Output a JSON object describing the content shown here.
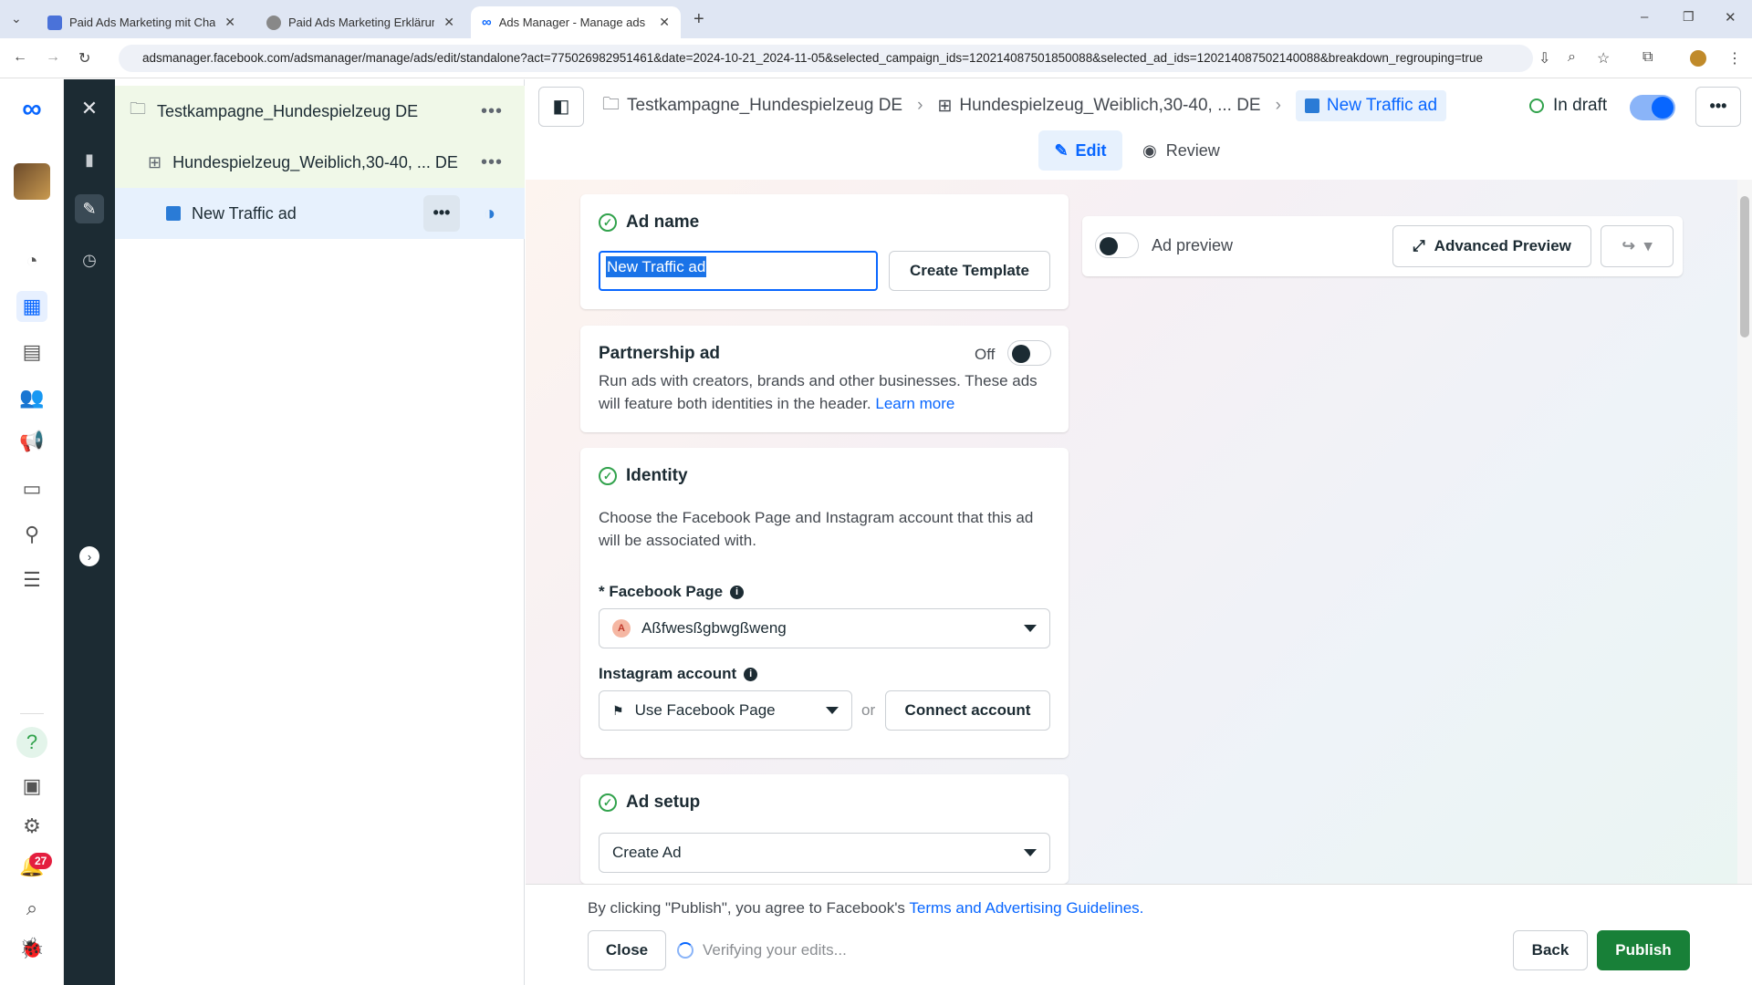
{
  "browser": {
    "tabs": [
      {
        "title": "Paid Ads Marketing mit ChatGPT",
        "fav_color": "#4a72d9"
      },
      {
        "title": "Paid Ads Marketing Erklärung",
        "fav_color": "#666"
      },
      {
        "title": "Ads Manager - Manage ads - A",
        "fav_color": "#0866ff"
      }
    ],
    "new_tab": "+",
    "url": "adsmanager.facebook.com/adsmanager/manage/ads/edit/standalone?act=775026982951461&date=2024-10-21_2024-11-05&selected_campaign_ids=120214087501850088&selected_ad_ids=120214087502140088&breakdown_regrouping=true"
  },
  "tree": {
    "campaign": "Testkampagne_Hundespielzeug DE",
    "adset": "Hundespielzeug_Weiblich,30-40, ... DE",
    "ad": "New Traffic ad",
    "more": "•••"
  },
  "breadcrumb": {
    "campaign": "Testkampagne_Hundespielzeug DE",
    "adset": "Hundespielzeug_Weiblich,30-40, ... DE",
    "ad": "New Traffic ad",
    "status": "In draft"
  },
  "mode_tabs": {
    "edit": "Edit",
    "review": "Review"
  },
  "ad_name": {
    "title": "Ad name",
    "value": "New Traffic ad",
    "create_template": "Create Template"
  },
  "partnership": {
    "title": "Partnership ad",
    "state": "Off",
    "description": "Run ads with creators, brands and other businesses. These ads will feature both identities in the header.",
    "learn_more": "Learn more"
  },
  "identity": {
    "title": "Identity",
    "description": "Choose the Facebook Page and Instagram account that this ad will be associated with.",
    "fb_label": "* Facebook Page",
    "fb_value": "Aßfwesßgbwgßweng",
    "fb_avatar": "A",
    "ig_label": "Instagram account",
    "ig_value": "Use Facebook Page",
    "or": "or",
    "connect": "Connect account"
  },
  "ad_setup": {
    "title": "Ad setup",
    "value": "Create Ad"
  },
  "preview": {
    "label": "Ad preview",
    "advanced": "Advanced Preview"
  },
  "footer": {
    "terms_prefix": "By clicking \"Publish\", you agree to Facebook's",
    "terms_link": "Terms and Advertising Guidelines.",
    "close": "Close",
    "verifying": "Verifying your edits...",
    "back": "Back",
    "publish": "Publish"
  },
  "notifications_badge": "27",
  "colors": {
    "accent": "#0866ff",
    "publish": "#188038",
    "check": "#31a24c"
  }
}
